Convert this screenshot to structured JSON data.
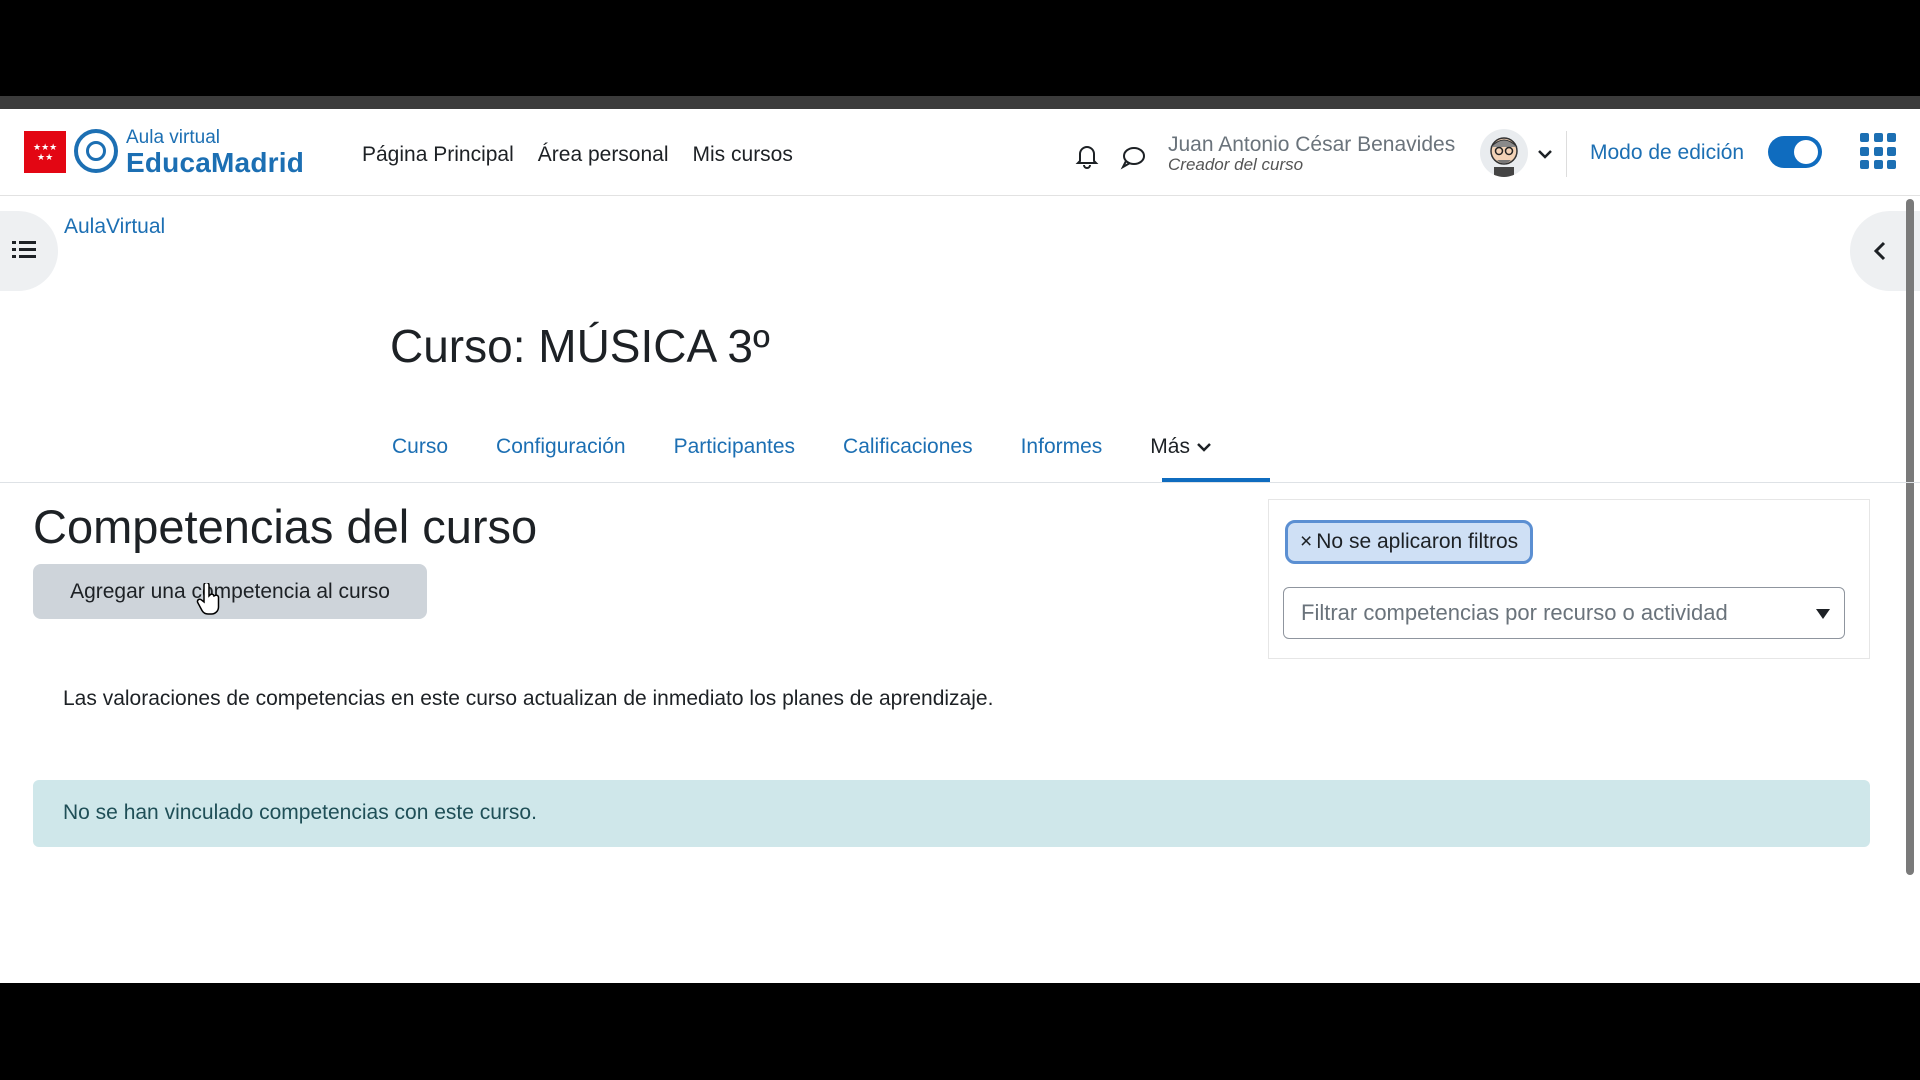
{
  "header": {
    "logo_line1": "Aula virtual",
    "logo_line2": "EducaMadrid",
    "nav": [
      "Página Principal",
      "Área personal",
      "Mis cursos"
    ],
    "user_name": "Juan Antonio César Benavides",
    "user_role": "Creador del curso",
    "edit_mode_label": "Modo de edición",
    "edit_mode_on": true
  },
  "breadcrumb": "AulaVirtual",
  "course": {
    "title": "Curso: MÚSICA 3º",
    "tabs": [
      "Curso",
      "Configuración",
      "Participantes",
      "Calificaciones",
      "Informes"
    ],
    "more_label": "Más",
    "active_tab": "Más"
  },
  "main": {
    "heading": "Competencias del curso",
    "add_button": "Agregar una competencia al curso",
    "info": "Las valoraciones de competencias en este curso actualizan de inmediato los planes de aprendizaje.",
    "alert": "No se han vinculado competencias con este curso."
  },
  "filter": {
    "chip_label": "No se aplicaron filtros",
    "chip_close": "×",
    "placeholder": "Filtrar competencias por recurso o actividad"
  },
  "colors": {
    "brand_blue": "#1c6fb3",
    "primary": "#0f6cbf",
    "alert_bg": "#cfe7ea",
    "flag_red": "#e30613"
  }
}
